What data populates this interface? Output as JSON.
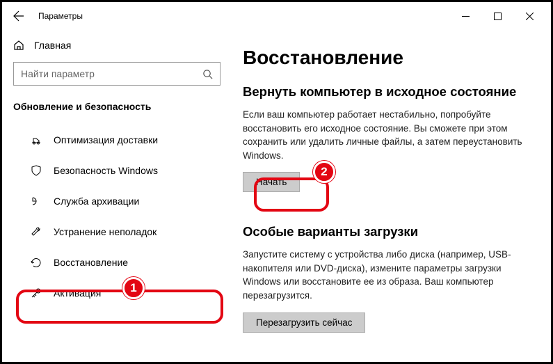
{
  "window": {
    "title": "Параметры"
  },
  "sidebar": {
    "home_label": "Главная",
    "search_placeholder": "Найти параметр",
    "section_label": "Обновление и безопасность",
    "items": [
      {
        "label": "Оптимизация доставки"
      },
      {
        "label": "Безопасность Windows"
      },
      {
        "label": "Служба архивации"
      },
      {
        "label": "Устранение неполадок"
      },
      {
        "label": "Восстановление"
      },
      {
        "label": "Активация"
      }
    ]
  },
  "main": {
    "title": "Восстановление",
    "reset": {
      "heading": "Вернуть компьютер в исходное состояние",
      "body": "Если ваш компьютер работает нестабильно, попробуйте восстановить его исходное состояние. Вы сможете при этом сохранить или удалить личные файлы, а затем переустановить Windows.",
      "button": "Начать"
    },
    "advanced": {
      "heading": "Особые варианты загрузки",
      "body": "Запустите систему с устройства либо диска (например, USB-накопителя или DVD-диска), измените параметры загрузки Windows или восстановите ее из образа. Ваш компьютер перезагрузится.",
      "button": "Перезагрузить сейчас"
    }
  },
  "annotations": {
    "badge1": "1",
    "badge2": "2"
  }
}
